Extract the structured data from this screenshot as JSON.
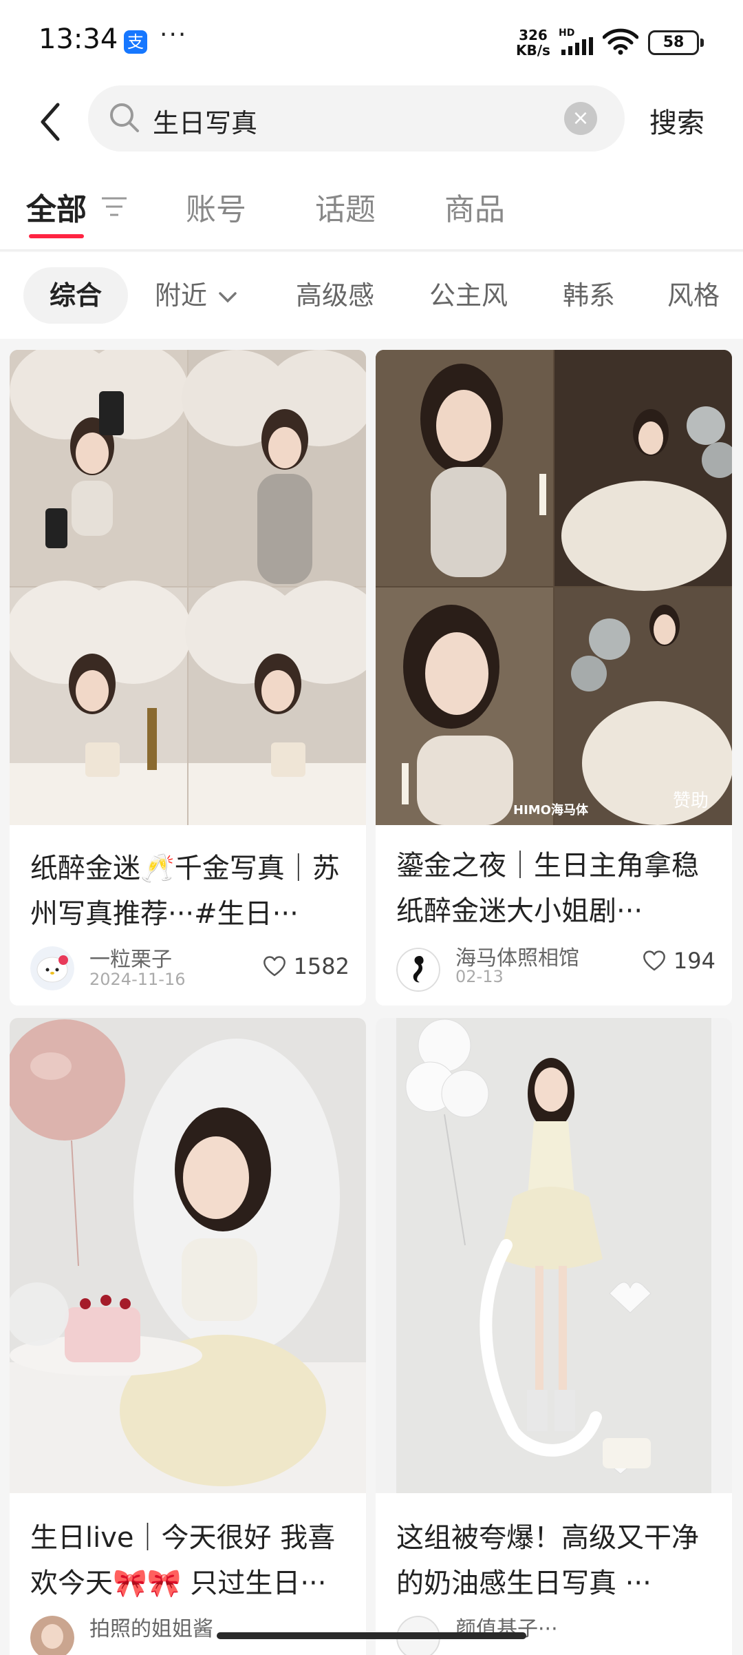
{
  "status_bar": {
    "time": "13:34",
    "net_speed_value": "326",
    "net_speed_unit": "KB/s",
    "hd_label": "HD",
    "battery": "58",
    "more": "···"
  },
  "search": {
    "query": "生日写真",
    "button_label": "搜索"
  },
  "tabs": [
    {
      "label": "全部"
    },
    {
      "label": "账号"
    },
    {
      "label": "话题"
    },
    {
      "label": "商品"
    }
  ],
  "filters": [
    {
      "label": "综合"
    },
    {
      "label": "附近"
    },
    {
      "label": "高级感"
    },
    {
      "label": "公主风"
    },
    {
      "label": "韩系"
    },
    {
      "label": "风格"
    }
  ],
  "cards": [
    {
      "title": "纸醉金迷🥂千金写真｜苏州写真推荐···#生日···",
      "author": "一粒栗子",
      "date": "2024-11-16",
      "likes": "1582"
    },
    {
      "title": "鎏金之夜｜生日主角拿稳纸醉金迷大小姐剧···",
      "author": "海马体照相馆",
      "date": "02-13",
      "likes": "194",
      "sponsor_tag": "赞助",
      "brand_mark": "HIMO海马体"
    },
    {
      "title": "生日live｜今天很好 我喜欢今天🎀🎀 只过生日···",
      "author": "拍照的姐姐酱"
    },
    {
      "title": "这组被夸爆！高级又干净的奶油感生日写真 ···",
      "author": "颜值基子···"
    }
  ],
  "colors": {
    "accent": "#ff2442",
    "background": "#f5f5f5",
    "card": "#ffffff",
    "text_primary": "#222222",
    "text_secondary": "#888888"
  },
  "icons": [
    "back-icon",
    "search-icon",
    "clear-icon",
    "filter-icon",
    "chevron-down-icon",
    "heart-icon",
    "wifi-icon",
    "signal-icon",
    "battery-icon",
    "alipay-icon"
  ]
}
